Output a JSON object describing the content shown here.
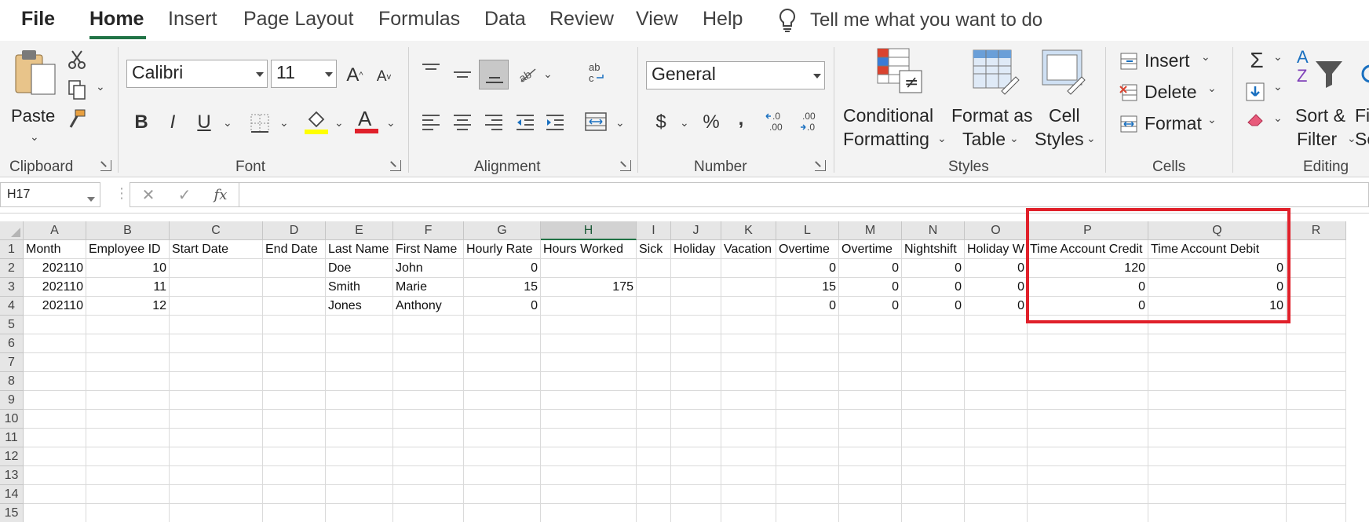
{
  "tabs": {
    "file": "File",
    "items": [
      "Home",
      "Insert",
      "Page Layout",
      "Formulas",
      "Data",
      "Review",
      "View",
      "Help"
    ],
    "active": "Home",
    "tell_me": "Tell me what you want to do"
  },
  "ribbon": {
    "clipboard": {
      "label": "Clipboard",
      "paste": "Paste"
    },
    "font": {
      "label": "Font",
      "name": "Calibri",
      "size": "11",
      "bold": "B",
      "italic": "I",
      "underline": "U",
      "grow": "A",
      "shrink": "A",
      "fill_color": "#ffff00",
      "font_color": "#e0202a",
      "font_color_letter": "A"
    },
    "alignment": {
      "label": "Alignment"
    },
    "number": {
      "label": "Number",
      "format": "General",
      "currency": "$",
      "percent": "%",
      "comma": ",",
      "inc_decimal": "←.0\n.00",
      "dec_decimal": ".00\n→.0"
    },
    "styles": {
      "label": "Styles",
      "conditional": [
        "Conditional",
        "Formatting"
      ],
      "format_table": [
        "Format as",
        "Table"
      ],
      "cell_styles": [
        "Cell",
        "Styles"
      ]
    },
    "cells": {
      "label": "Cells",
      "insert": "Insert",
      "delete": "Delete",
      "format": "Format"
    },
    "editing": {
      "label": "Editing",
      "sort_filter": [
        "Sort &",
        "Filter"
      ],
      "find_select": [
        "Fi",
        "Se"
      ]
    }
  },
  "formula_bar": {
    "name_box": "H17",
    "fx": "fx",
    "value": ""
  },
  "sheet": {
    "columns": [
      "A",
      "B",
      "C",
      "D",
      "E",
      "F",
      "G",
      "H",
      "I",
      "J",
      "K",
      "L",
      "M",
      "N",
      "O",
      "P",
      "Q",
      "R"
    ],
    "selected_column": "H",
    "row_numbers": [
      "1",
      "2",
      "3",
      "4",
      "5",
      "6",
      "7",
      "8",
      "9",
      "10",
      "11",
      "12",
      "13",
      "14",
      "15"
    ],
    "headers": [
      "Month",
      "Employee ID",
      "Start Date",
      "End Date",
      "Last Name",
      "First Name",
      "Hourly Rate",
      "Hours Worked",
      "Sick",
      "Holiday",
      "Vacation",
      "Overtime",
      "Overtime",
      "Nightshift",
      "Holiday W",
      "Time Account Credit",
      "Time Account Debit",
      ""
    ],
    "rows": [
      [
        "202110",
        "10",
        "",
        "",
        "Doe",
        "John",
        "0",
        "",
        "",
        "",
        "",
        "0",
        "0",
        "0",
        "0",
        "120",
        "0",
        ""
      ],
      [
        "202110",
        "11",
        "",
        "",
        "Smith",
        "Marie",
        "15",
        "175",
        "",
        "",
        "",
        "15",
        "0",
        "0",
        "0",
        "0",
        "0",
        ""
      ],
      [
        "202110",
        "12",
        "",
        "",
        "Jones",
        "Anthony",
        "0",
        "",
        "",
        "",
        "",
        "0",
        "0",
        "0",
        "0",
        "0",
        "10",
        ""
      ]
    ]
  },
  "colors": {
    "accent": "#217346",
    "highlight_box": "#e0202a"
  }
}
